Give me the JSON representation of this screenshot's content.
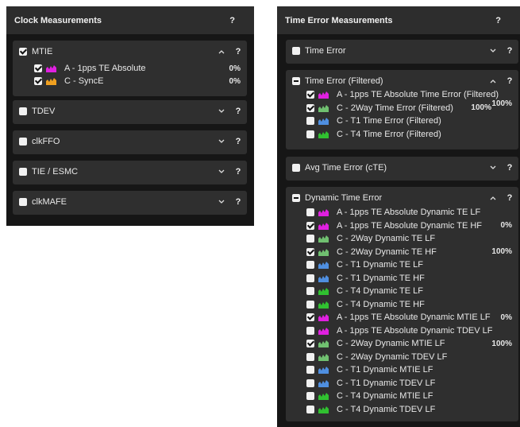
{
  "clock": {
    "title": "Clock Measurements",
    "help": "?",
    "sections": [
      {
        "label": "MTIE",
        "state": "checked",
        "expanded": true,
        "items": [
          {
            "label": "A - 1pps TE Absolute",
            "color": "#e020e0",
            "checked": true,
            "value": "0%"
          },
          {
            "label": "C - SyncE",
            "color": "#f0a020",
            "checked": true,
            "value": "0%"
          }
        ]
      },
      {
        "label": "TDEV",
        "state": "unchecked",
        "expanded": false,
        "items": []
      },
      {
        "label": "clkFFO",
        "state": "unchecked",
        "expanded": false,
        "items": []
      },
      {
        "label": "TIE / ESMC",
        "state": "unchecked",
        "expanded": false,
        "items": []
      },
      {
        "label": "clkMAFE",
        "state": "unchecked",
        "expanded": false,
        "items": []
      }
    ]
  },
  "time_error": {
    "title": "Time Error Measurements",
    "help": "?",
    "sections": [
      {
        "label": "Time Error",
        "state": "unchecked",
        "expanded": false,
        "items": []
      },
      {
        "label": "Time Error (Filtered)",
        "state": "partial",
        "expanded": true,
        "items": [
          {
            "label": "A - 1pps TE Absolute Time Error (Filtered)",
            "color": "#e020e0",
            "checked": true,
            "value": ""
          },
          {
            "label": "C - 2Way Time Error (Filtered)",
            "color": "#70c070",
            "checked": true,
            "value": "100%",
            "value2": "100%"
          },
          {
            "label": "C - T1 Time Error (Filtered)",
            "color": "#4f8fe0",
            "checked": false,
            "value": ""
          },
          {
            "label": "C - T4 Time Error (Filtered)",
            "color": "#30c030",
            "checked": false,
            "value": ""
          }
        ]
      },
      {
        "label": "Avg Time Error (cTE)",
        "state": "unchecked",
        "expanded": false,
        "items": []
      },
      {
        "label": "Dynamic Time Error",
        "state": "partial",
        "expanded": true,
        "items": [
          {
            "label": "A - 1pps TE Absolute Dynamic TE LF",
            "color": "#e020e0",
            "checked": false,
            "value": ""
          },
          {
            "label": "A - 1pps TE Absolute Dynamic TE HF",
            "color": "#e020e0",
            "checked": true,
            "value": "0%"
          },
          {
            "label": "C - 2Way Dynamic TE LF",
            "color": "#70c070",
            "checked": false,
            "value": ""
          },
          {
            "label": "C - 2Way Dynamic TE HF",
            "color": "#70c070",
            "checked": true,
            "value": "100%"
          },
          {
            "label": "C - T1 Dynamic TE LF",
            "color": "#4f8fe0",
            "checked": false,
            "value": ""
          },
          {
            "label": "C - T1 Dynamic TE HF",
            "color": "#4f8fe0",
            "checked": false,
            "value": ""
          },
          {
            "label": "C - T4 Dynamic TE LF",
            "color": "#30c030",
            "checked": false,
            "value": ""
          },
          {
            "label": "C - T4 Dynamic TE HF",
            "color": "#30c030",
            "checked": false,
            "value": ""
          },
          {
            "label": "A - 1pps TE Absolute Dynamic MTIE LF",
            "color": "#e020e0",
            "checked": true,
            "value": "0%"
          },
          {
            "label": "A - 1pps TE Absolute Dynamic TDEV LF",
            "color": "#e020e0",
            "checked": false,
            "value": ""
          },
          {
            "label": "C - 2Way Dynamic MTIE LF",
            "color": "#70c070",
            "checked": true,
            "value": "100%"
          },
          {
            "label": "C - 2Way Dynamic TDEV LF",
            "color": "#70c070",
            "checked": false,
            "value": ""
          },
          {
            "label": "C - T1 Dynamic MTIE LF",
            "color": "#4f8fe0",
            "checked": false,
            "value": ""
          },
          {
            "label": "C - T1 Dynamic TDEV LF",
            "color": "#4f8fe0",
            "checked": false,
            "value": ""
          },
          {
            "label": "C - T4 Dynamic MTIE LF",
            "color": "#30c030",
            "checked": false,
            "value": ""
          },
          {
            "label": "C - T4 Dynamic TDEV LF",
            "color": "#30c030",
            "checked": false,
            "value": ""
          }
        ]
      }
    ]
  }
}
